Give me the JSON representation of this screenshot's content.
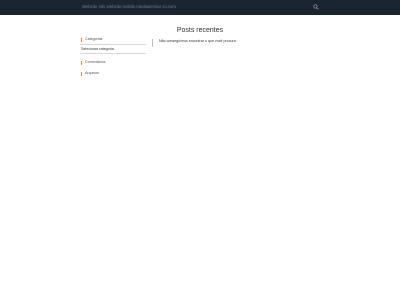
{
  "header": {
    "site_text": "Website info website.mobile.mediaservice.ro.com",
    "search_icon": "search-icon"
  },
  "main": {
    "title": "Posts recentes",
    "empty_message": "Não conseguimos encontrar o que você procura."
  },
  "sidebar": {
    "categories": {
      "title": "Categorias",
      "selected": "Selecionar categoria"
    },
    "comments": {
      "title": "Comentários"
    },
    "archives": {
      "title": "Arquivos"
    }
  },
  "colors": {
    "topbar": "#1b2530",
    "accent": "#f0872b"
  }
}
